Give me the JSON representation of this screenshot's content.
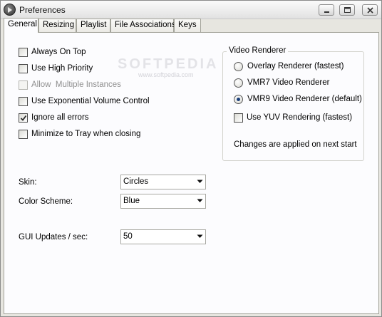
{
  "window": {
    "title": "Preferences"
  },
  "titlebar_buttons": [
    "minimize-icon",
    "maximize-icon",
    "close-icon"
  ],
  "tabs": [
    {
      "label": "General",
      "active": true
    },
    {
      "label": "Resizing",
      "active": false
    },
    {
      "label": "Playlist",
      "active": false
    },
    {
      "label": "File Associations",
      "active": false
    },
    {
      "label": "Keys",
      "active": false
    }
  ],
  "watermark": {
    "main": "SOFTPEDIA",
    "small": "www.softpedia.com"
  },
  "general": {
    "checkboxes": [
      {
        "label": "Always On Top",
        "checked": false,
        "enabled": true
      },
      {
        "label": "Use High Priority",
        "checked": false,
        "enabled": true
      },
      {
        "label": "Allow  Multiple Instances",
        "checked": false,
        "enabled": false
      },
      {
        "label": "Use Exponential Volume Control",
        "checked": false,
        "enabled": true
      },
      {
        "label": "Ignore all errors",
        "checked": true,
        "enabled": true
      },
      {
        "label": "Minimize to Tray when closing",
        "checked": false,
        "enabled": true
      }
    ],
    "video_renderer": {
      "title": "Video Renderer",
      "radios": [
        {
          "label": "Overlay Renderer (fastest)",
          "selected": false
        },
        {
          "label": "VMR7 Video Renderer",
          "selected": false
        },
        {
          "label": "VMR9 Video Renderer (default)",
          "selected": true
        }
      ],
      "yuv": {
        "label": "Use YUV Rendering (fastest)",
        "checked": false
      },
      "note": "Changes are applied on next start"
    },
    "skin": {
      "label": "Skin:",
      "value": "Circles"
    },
    "color_scheme": {
      "label": "Color Scheme:",
      "value": "Blue"
    },
    "gui_updates": {
      "label": "GUI Updates / sec:",
      "value": "50"
    }
  },
  "colors": {
    "accent": "#1b3f7a",
    "panel_bg": "#fcfcfe",
    "window_bg": "#e7e6e0"
  }
}
